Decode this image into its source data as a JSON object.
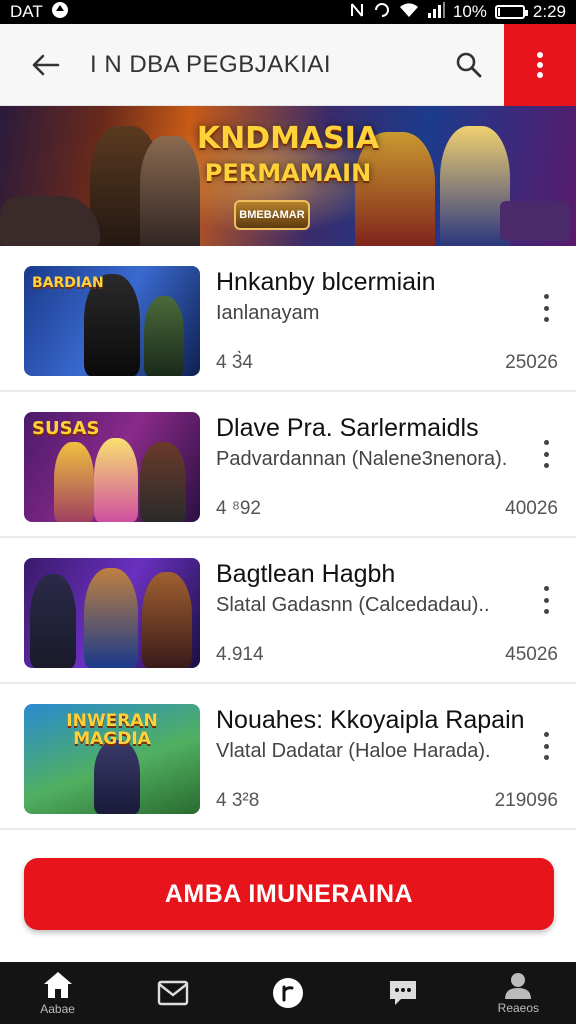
{
  "status_bar": {
    "left_text": "DAT",
    "battery_percent": "10%",
    "time": "2:29",
    "battery_level": 0.1
  },
  "app_bar": {
    "title": "I N DBA PEGBJAKIAI"
  },
  "banner": {
    "title_line1": "KNDMASIA",
    "title_line2": "PERMAMAIN",
    "badge_text": "BMEBAMAR"
  },
  "games": [
    {
      "title": "Hnkanby blcermiain",
      "subtitle": "Ianlanayam",
      "rating": "4 3̀4",
      "count": "25026",
      "thumb_text": "BARDIAN"
    },
    {
      "title": "Dlave Pra. Sarlermaidls",
      "subtitle": "Padvardannan (Nalene3nenora).",
      "rating": "4 ⁸92",
      "count": "40026",
      "thumb_text": "SUSAS"
    },
    {
      "title": "Bagtlean Hagbh",
      "subtitle": "Slatal Gadasnn (Calcedadau)..",
      "rating": "4.914",
      "count": "45026",
      "thumb_text": ""
    },
    {
      "title": "Nouahes: Kkoyaipla Rapain",
      "subtitle": "Vlatal Dadatar (Haloe Harada).",
      "rating": "4 3²8",
      "count": "219096",
      "thumb_text": "INWERAN MAGDIA"
    }
  ],
  "cta": {
    "label": "AMBA IMUNERAINA"
  },
  "bottom_nav": {
    "items": [
      {
        "label": "Aabae",
        "icon": "home-icon"
      },
      {
        "label": "",
        "icon": "mail-icon"
      },
      {
        "label": "",
        "icon": "circle-r-icon"
      },
      {
        "label": "",
        "icon": "chat-icon"
      },
      {
        "label": "Reaeos",
        "icon": "profile-icon"
      }
    ]
  },
  "colors": {
    "accent": "#e8141b",
    "nav_bg": "#141414",
    "app_bar_bg": "#f7f7f7"
  }
}
